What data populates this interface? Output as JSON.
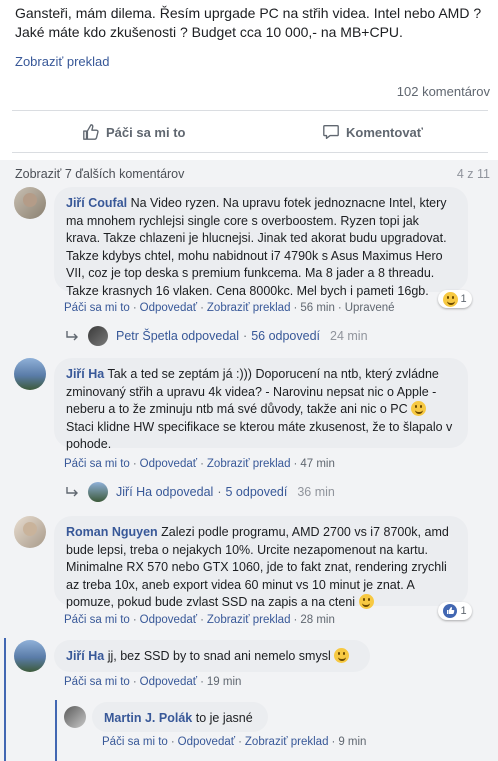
{
  "post": {
    "text": "Gansteři, mám dilema. Řesím uprgade PC na střih videa. Intel nebo AMD ? Jaké máte kdo zkušenosti ? Budget cca 10 000,- na MB+CPU.",
    "translate_link": "Zobraziť preklad",
    "comment_count": "102 komentárov"
  },
  "actions": {
    "like": "Páči sa mi to",
    "comment": "Komentovať"
  },
  "comments_header": {
    "more": "Zobraziť 7 ďalších komentárov",
    "paging": "4 z 11"
  },
  "comments": [
    {
      "author": "Jiří Coufal",
      "text": "Na Video ryzen. Na upravu fotek jednoznacne Intel, ktery ma mnohem rychlejsi single core s overboostem. Ryzen topi jak krava. Takze chlazeni je hlucnejsi. Jinak ted akorat budu upgradovat. Takze kdybys chtel, mohu nabidnout i7 4790k s Asus Maximus Hero VII, coz je top deska s premium funkcema. Ma 8 jader a 8 threadu. Takze krasnych 16 vlaken. Cena 8000kc. Mel bych i pameti 16gb.",
      "like": "Páči sa mi to",
      "reply": "Odpovedať",
      "translate": "Zobraziť preklad",
      "time": "56 min",
      "edited": "Upravené",
      "reaction_count": "1",
      "replies_summary": {
        "name": "Petr Špetla",
        "action": "odpovedal",
        "count": "56 odpovedí",
        "time": "24 min"
      }
    },
    {
      "author": "Jiří Ha",
      "text": "Tak a ted se zeptám já :))) Doporucení na ntb, který zvládne zminovaný střih a upravu 4k videa? - Narovinu nepsat nic o Apple - neberu a to že zminuju ntb má své důvody, takže ani nic o PC",
      "text_tail": "Staci klidne HW specifikace se kterou máte zkusenost, že to šlapalo v pohode.",
      "like": "Páči sa mi to",
      "reply": "Odpovedať",
      "translate": "Zobraziť preklad",
      "time": "47 min",
      "replies_summary": {
        "name": "Jiří Ha",
        "action": "odpovedal",
        "count": "5 odpovedí",
        "time": "36 min"
      }
    },
    {
      "author": "Roman Nguyen",
      "text": "Zalezi podle programu, AMD 2700 vs i7 8700k, amd bude lepsi, treba o nejakych 10%. Urcite nezapomenout na kartu. Minimalne RX 570 nebo GTX 1060, jde to fakt znat, rendering zrychli az treba 10x, aneb export videa 60 minut vs 10 minut je znat. A pomuze, pokud bude zvlast SSD na zapis a na cteni",
      "like": "Páči sa mi to",
      "reply": "Odpovedať",
      "translate": "Zobraziť preklad",
      "time": "28 min",
      "reaction_count": "1"
    },
    {
      "author": "Jiří Ha",
      "text": "jj, bez SSD by to snad ani nemelo smysl",
      "like": "Páči sa mi to",
      "reply": "Odpovedať",
      "time": "19 min"
    },
    {
      "author": "Martin J. Polák",
      "text": "to je jasné",
      "like": "Páči sa mi to",
      "reply": "Odpovedať",
      "translate": "Zobraziť preklad",
      "time": "9 min"
    }
  ],
  "colors": {
    "link": "#385898",
    "bubble": "#ebedf0",
    "bg": "#f2f3f5",
    "accent": "#4267b2"
  }
}
